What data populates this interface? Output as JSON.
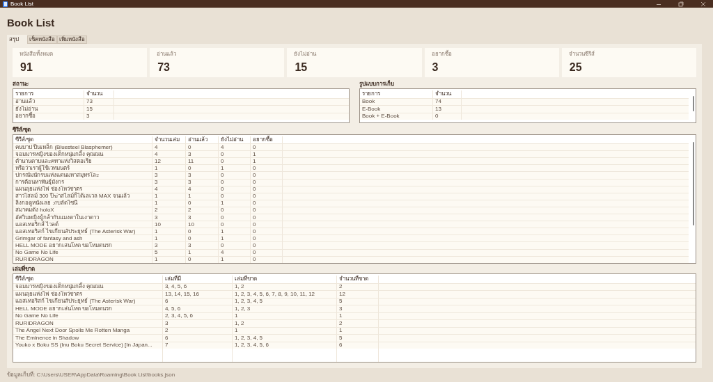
{
  "window": {
    "title": "Book List"
  },
  "heading": "Book List",
  "tabs": [
    {
      "label": "สรุป",
      "selected": true
    },
    {
      "label": "เช็คหนังสือ",
      "selected": false
    },
    {
      "label": "เพิ่มหนังสือ",
      "selected": false
    }
  ],
  "stats": [
    {
      "label": "หนังสือทั้งหมด",
      "value": "91"
    },
    {
      "label": "อ่านแล้ว",
      "value": "73"
    },
    {
      "label": "ยังไม่อ่าน",
      "value": "15"
    },
    {
      "label": "อยากซื้อ",
      "value": "3"
    },
    {
      "label": "จำนวนซีรีส์",
      "value": "25"
    }
  ],
  "status_table": {
    "title": "สถานะ",
    "columns": [
      "รายการ",
      "จำนวน"
    ],
    "rows": [
      [
        "อ่านแล้ว",
        "73"
      ],
      [
        "ยังไม่อ่าน",
        "15"
      ],
      [
        "อยากซื้อ",
        "3"
      ]
    ]
  },
  "format_table": {
    "title": "รูปแบบการเก็บ",
    "columns": [
      "รายการ",
      "จำนวน"
    ],
    "rows": [
      [
        "Book",
        "74"
      ],
      [
        "E-Book",
        "13"
      ],
      [
        "Book + E-Book",
        "0"
      ]
    ]
  },
  "series_table": {
    "title": "ซีรีส์/ชุด",
    "columns": [
      "ซีรีส์/ชุด",
      "จำนวนเล่ม",
      "อ่านแล้ว",
      "ยังไม่อ่าน",
      "อยากซื้อ"
    ],
    "rows": [
      [
        "คนบาป ปืนเหล็ก (Bluesteel Blasphemer)",
        "4",
        "0",
        "4",
        "0"
      ],
      [
        "จอมมารหญิงของเด็กหนุ่มกลิ้ง คุณณน",
        "4",
        "3",
        "0",
        "1"
      ],
      [
        "ตำนานดาบและคทาแห่งวิสตอเรีย",
        "12",
        "11",
        "0",
        "1"
      ],
      [
        "หรือว่าเราผู้ใช้เวทมนตร์",
        "1",
        "0",
        "1",
        "0"
      ],
      [
        "ปกรณัมนักรบแห่งแดนมหาสมุทรโละ",
        "3",
        "3",
        "0",
        "0"
      ],
      [
        "การต้อนหาพันธุ์มังกร",
        "3",
        "3",
        "0",
        "0"
      ],
      [
        "แผนลุยแห่งไฟ ช่องโหว่ชาตร",
        "4",
        "4",
        "0",
        "0"
      ],
      [
        "สาวไสลม์ 300 ปีฆ่าสไลม์ก็ได้เลเวล MAX จนแล้ว",
        "1",
        "1",
        "0",
        "0"
      ],
      [
        "ลิงกอดูหนังเลย ://บลัดไซนี",
        "1",
        "0",
        "1",
        "0"
      ],
      [
        "สมาคมดัง holoX",
        "2",
        "2",
        "0",
        "0"
      ],
      [
        "อัศวินหญิงผู้กล้ากับแมงดาในเงาดาว",
        "3",
        "3",
        "0",
        "0"
      ],
      [
        "แอสเทอริกส์ ไวลด์",
        "10",
        "10",
        "0",
        "0"
      ],
      [
        "แอสเทอริสก์ ไขเกียนสัประยุทธ์ (The Asterisk War)",
        "1",
        "0",
        "1",
        "0"
      ],
      [
        "Grimgar of fantasy and ash",
        "1",
        "0",
        "1",
        "0"
      ],
      [
        "HELL MODE อยากเล่นโหด ขอโหมดนรก",
        "3",
        "3",
        "0",
        "0"
      ],
      [
        "No Game No Life",
        "5",
        "1",
        "4",
        "0"
      ],
      [
        "RURIDRAGON",
        "1",
        "0",
        "1",
        "0"
      ]
    ]
  },
  "missing_table": {
    "title": "เล่มที่ขาด",
    "columns": [
      "ซีรีส์/ชุด",
      "เล่มที่มี",
      "เล่มที่ขาด",
      "จำนวนที่ขาด"
    ],
    "rows": [
      [
        "จอมมารหญิงของเด็กหนุ่มกลิ้ง คุณณน",
        "3, 4, 5, 6",
        "1, 2",
        "2"
      ],
      [
        "แผนลุยแห่งไฟ ช่องโหว่ชาตร",
        "13, 14, 15, 16",
        "1, 2, 3, 4, 5, 6, 7, 8, 9, 10, 11, 12",
        "12"
      ],
      [
        "แอสเทอริสก์ ไขเกียนสัประยุทธ์ (The Asterisk War)",
        "6",
        "1, 2, 3, 4, 5",
        "5"
      ],
      [
        "HELL MODE อยากเล่นโหด ขอโหมดนรก",
        "4, 5, 6",
        "1, 2, 3",
        "3"
      ],
      [
        "No Game No Life",
        "2, 3, 4, 5, 6",
        "1",
        "1"
      ],
      [
        "RURIDRAGON",
        "3",
        "1, 2",
        "2"
      ],
      [
        "The Angel Next Door Spoils Me Rotten Manga",
        "2",
        "1",
        "1"
      ],
      [
        "The Eminence in Shadow",
        "6",
        "1, 2, 3, 4, 5",
        "5"
      ],
      [
        "Youko x Boku SS (Inu Boku Secret Service) [In Japan...",
        "7",
        "1, 2, 3, 4, 5, 6",
        "6"
      ]
    ]
  },
  "status_bar": "ข้อมูลเก็บที่: C:\\Users\\USER\\AppData\\Roaming\\Book List\\books.json"
}
